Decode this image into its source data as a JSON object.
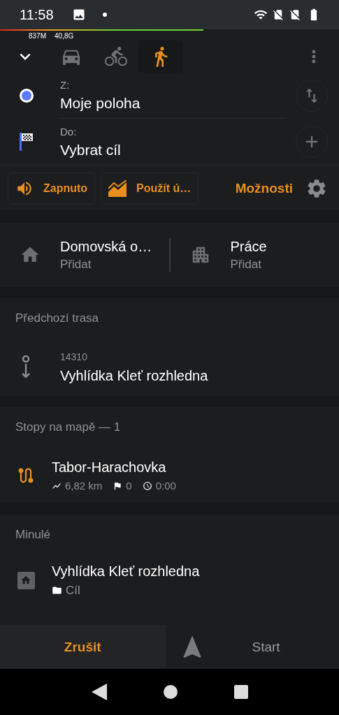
{
  "status_bar": {
    "time": "11:58"
  },
  "memory": {
    "level": 0.6,
    "used": "837M",
    "free": "40,8G"
  },
  "modes": [
    {
      "kind": "car",
      "selected": false
    },
    {
      "kind": "bike",
      "selected": false
    },
    {
      "kind": "walk",
      "selected": true
    }
  ],
  "route": {
    "from": {
      "label": "Z:",
      "value": "Moje poloha"
    },
    "to": {
      "label": "Do:",
      "value": "Vybrat cíl"
    }
  },
  "chips": [
    {
      "kind": "sound",
      "label": "Zapnuto"
    },
    {
      "kind": "elevation",
      "label": "Použít ú…"
    }
  ],
  "options_label": "Možnosti",
  "favorites": [
    {
      "kind": "home",
      "title": "Domovská o…",
      "subtitle": "Přidat"
    },
    {
      "kind": "work",
      "title": "Práce",
      "subtitle": "Přidat"
    }
  ],
  "previous_route": {
    "header": "Předchozí trasa",
    "number": "14310",
    "title": "Vyhlídka Kleť rozhledna"
  },
  "tracks": {
    "header": "Stopy na mapě — 1",
    "items": [
      {
        "name": "Tabor-Harachovka",
        "distance": "6,82 km",
        "points": "0",
        "time": "0:00"
      }
    ]
  },
  "history": {
    "header": "Minulé",
    "items": [
      {
        "title": "Vyhlídka Kleť rozhledna",
        "category": "Cíl"
      }
    ]
  },
  "buttons": {
    "cancel": "Zrušit",
    "start": "Start"
  }
}
